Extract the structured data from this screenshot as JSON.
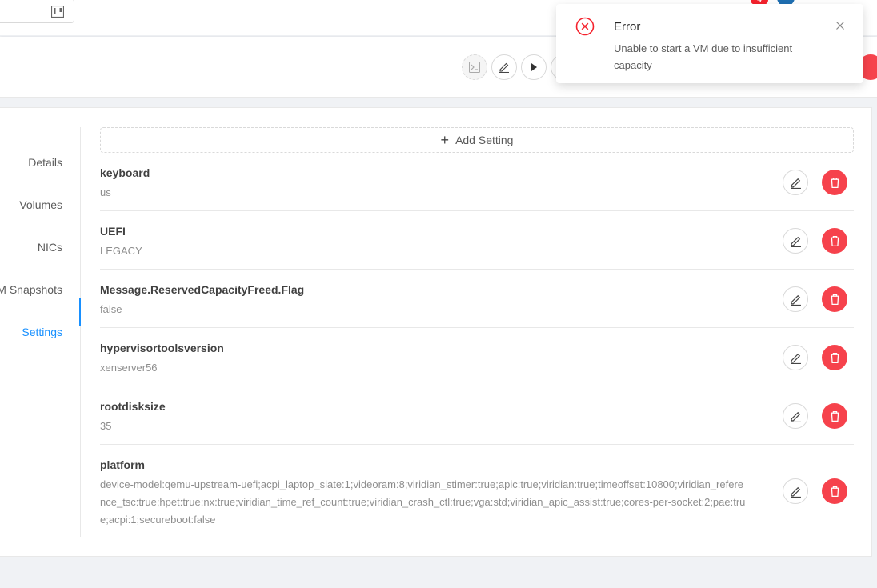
{
  "header": {
    "notification_count": "4"
  },
  "notification": {
    "title": "Error",
    "description": "Unable to start a VM due to insufficient capacity",
    "status_color": "#f5222d"
  },
  "actions": {
    "icons": [
      "console-icon",
      "edit-icon",
      "play-icon"
    ]
  },
  "tabs": [
    {
      "label": "Details",
      "active": false
    },
    {
      "label": "Volumes",
      "active": false
    },
    {
      "label": "NICs",
      "active": false
    },
    {
      "label": "VM Snapshots",
      "active": false
    },
    {
      "label": "Settings",
      "active": true
    }
  ],
  "settings": {
    "add_label": "Add Setting",
    "items": [
      {
        "key": "keyboard",
        "value": "us"
      },
      {
        "key": "UEFI",
        "value": "LEGACY"
      },
      {
        "key": "Message.ReservedCapacityFreed.Flag",
        "value": "false"
      },
      {
        "key": "hypervisortoolsversion",
        "value": "xenserver56"
      },
      {
        "key": "rootdisksize",
        "value": "35"
      },
      {
        "key": "platform",
        "value": "device-model:qemu-upstream-uefi;acpi_laptop_slate:1;videoram:8;viridian_stimer:true;apic:true;viridian:true;timeoffset:10800;viridian_reference_tsc:true;hpet:true;nx:true;viridian_time_ref_count:true;viridian_crash_ctl:true;vga:std;viridian_apic_assist:true;cores-per-socket:2;pae:true;acpi:1;secureboot:false"
      }
    ]
  },
  "colors": {
    "accent": "#1890ff",
    "danger": "#f5222d"
  }
}
